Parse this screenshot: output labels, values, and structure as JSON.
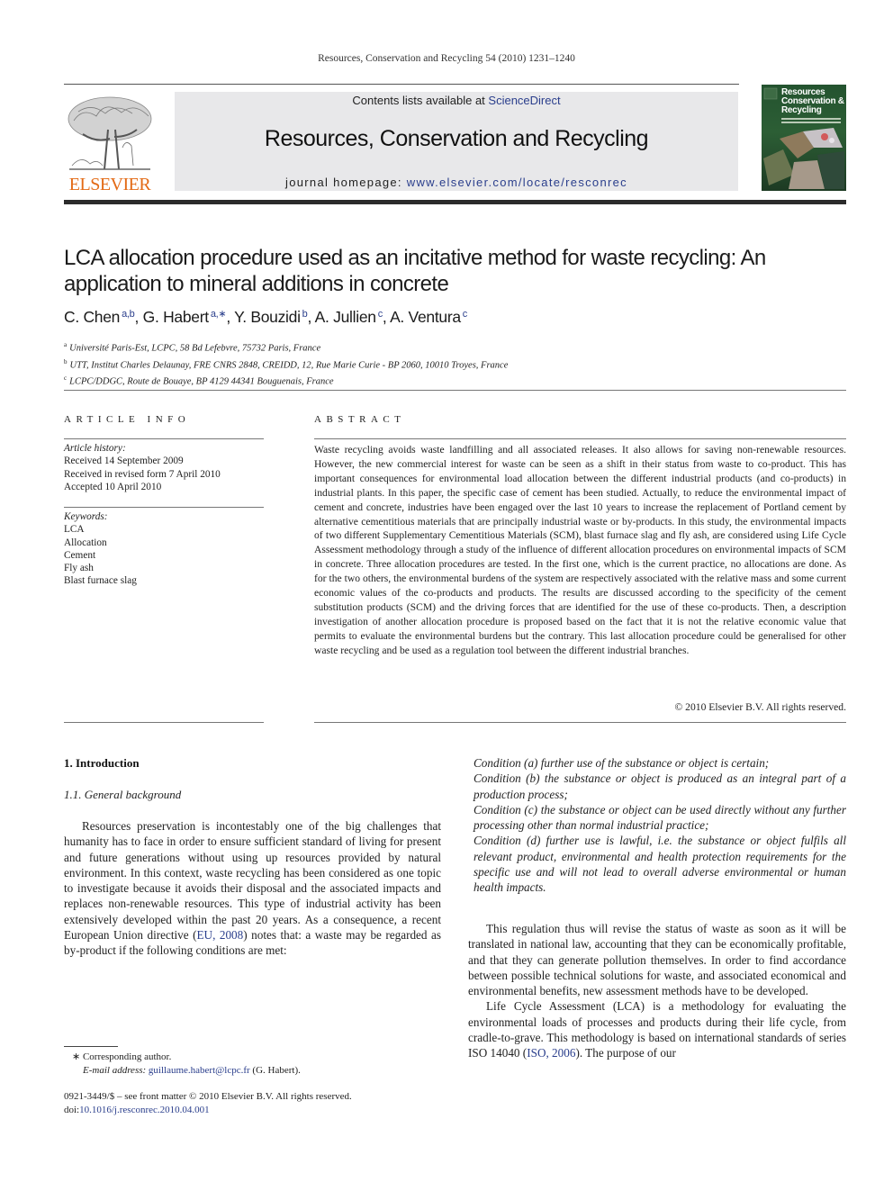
{
  "running_head": "Resources, Conservation and Recycling 54 (2010) 1231–1240",
  "publisher": {
    "wordmark": "ELSEVIER",
    "brand_color": "#e36a15"
  },
  "banner": {
    "contents_prefix": "Contents lists available at ",
    "contents_link": "ScienceDirect",
    "journal_title": "Resources, Conservation and Recycling",
    "homepage_prefix": "journal homepage: ",
    "homepage_link": "www.elsevier.com/locate/resconrec"
  },
  "cover": {
    "title_lines": [
      "Resources",
      "Conservation &",
      "Recycling"
    ]
  },
  "article": {
    "title": "LCA allocation procedure used as an incitative method for waste recycling: An application to mineral additions in concrete",
    "authors": [
      {
        "name": "C. Chen",
        "sup": "a,b",
        "sep": ", "
      },
      {
        "name": "G. Habert",
        "sup": "a,∗",
        "sep": ", "
      },
      {
        "name": "Y. Bouzidi",
        "sup": "b",
        "sep": ", "
      },
      {
        "name": "A. Jullien",
        "sup": "c",
        "sep": ", "
      },
      {
        "name": "A. Ventura",
        "sup": "c",
        "sep": ""
      }
    ],
    "affiliations": [
      {
        "mark": "a",
        "text": "Université Paris-Est, LCPC, 58 Bd Lefebvre, 75732 Paris, France"
      },
      {
        "mark": "b",
        "text": "UTT, Institut Charles Delaunay, FRE CNRS 2848, CREIDD, 12, Rue Marie Curie - BP 2060, 10010 Troyes, France"
      },
      {
        "mark": "c",
        "text": "LCPC/DDGC, Route de Bouaye, BP 4129 44341 Bouguenais, France"
      }
    ]
  },
  "article_info": {
    "heading": "ARTICLE INFO",
    "history_label": "Article history:",
    "history": [
      "Received 14 September 2009",
      "Received in revised form 7 April 2010",
      "Accepted 10 April 2010"
    ],
    "keywords_label": "Keywords:",
    "keywords": [
      "LCA",
      "Allocation",
      "Cement",
      "Fly ash",
      "Blast furnace slag"
    ]
  },
  "abstract": {
    "heading": "ABSTRACT",
    "text": "Waste recycling avoids waste landfilling and all associated releases. It also allows for saving non-renewable resources. However, the new commercial interest for waste can be seen as a shift in their status from waste to co-product. This has important consequences for environmental load allocation between the different industrial products (and co-products) in industrial plants. In this paper, the specific case of cement has been studied. Actually, to reduce the environmental impact of cement and concrete, industries have been engaged over the last 10 years to increase the replacement of Portland cement by alternative cementitious materials that are principally industrial waste or by-products. In this study, the environmental impacts of two different Supplementary Cementitious Materials (SCM), blast furnace slag and fly ash, are considered using Life Cycle Assessment methodology through a study of the influence of different allocation procedures on environmental impacts of SCM in concrete. Three allocation procedures are tested. In the first one, which is the current practice, no allocations are done. As for the two others, the environmental burdens of the system are respectively associated with the relative mass and some current economic values of the co-products and products. The results are discussed according to the specificity of the cement substitution products (SCM) and the driving forces that are identified for the use of these co-products. Then, a description investigation of another allocation procedure is proposed based on the fact that it is not the relative economic value that permits to evaluate the environmental burdens but the contrary. This last allocation procedure could be generalised for other waste recycling and be used as a regulation tool between the different industrial branches.",
    "copyright": "© 2010 Elsevier B.V. All rights reserved."
  },
  "body": {
    "section_heading": "1.  Introduction",
    "subsection_heading": "1.1.  General background",
    "left_para_before_link": "Resources preservation is incontestably one of the big challenges that humanity has to face in order to ensure sufficient standard of living for present and future generations without using up resources provided by natural environment. In this context, waste recycling has been considered as one topic to investigate because it avoids their disposal and the associated impacts and replaces non-renewable resources. This type of industrial activity has been extensively developed within the past 20 years. As a consequence, a recent European Union directive (",
    "left_para_link": "EU, 2008",
    "left_para_after_link": ") notes that: a waste may be regarded as by-product if the following conditions are met:",
    "conditions": [
      "Condition (a) further use of the substance or object is certain;",
      "Condition (b) the substance or object is produced as an integral part of a production process;",
      "Condition (c) the substance or object can be used directly without any further processing other than normal industrial practice;",
      "Condition (d) further use is lawful, i.e. the substance or object fulfils all relevant product, environmental and health protection requirements for the specific use and will not lead to overall adverse environmental or human health impacts."
    ],
    "right_para1": "This regulation thus will revise the status of waste as soon as it will be translated in national law, accounting that they can be economically profitable, and that they can generate pollution themselves. In order to find accordance between possible technical solutions for waste, and associated economical and environmental benefits, new assessment methods have to be developed.",
    "right_para2_before_link": "Life Cycle Assessment (LCA) is a methodology for evaluating the environmental loads of processes and products during their life cycle, from cradle-to-grave. This methodology is based on international standards of series ISO 14040 (",
    "right_para2_link": "ISO, 2006",
    "right_para2_after_link": "). The purpose of our"
  },
  "footnote": {
    "corresponding": "∗  Corresponding author.",
    "email_label": "E-mail address: ",
    "email": "guillaume.habert@lcpc.fr",
    "email_suffix": " (G. Habert)."
  },
  "front_matter": {
    "issn_line": "0921-3449/$ – see front matter © 2010 Elsevier B.V. All rights reserved.",
    "doi_prefix": "doi:",
    "doi": "10.1016/j.resconrec.2010.04.001"
  }
}
